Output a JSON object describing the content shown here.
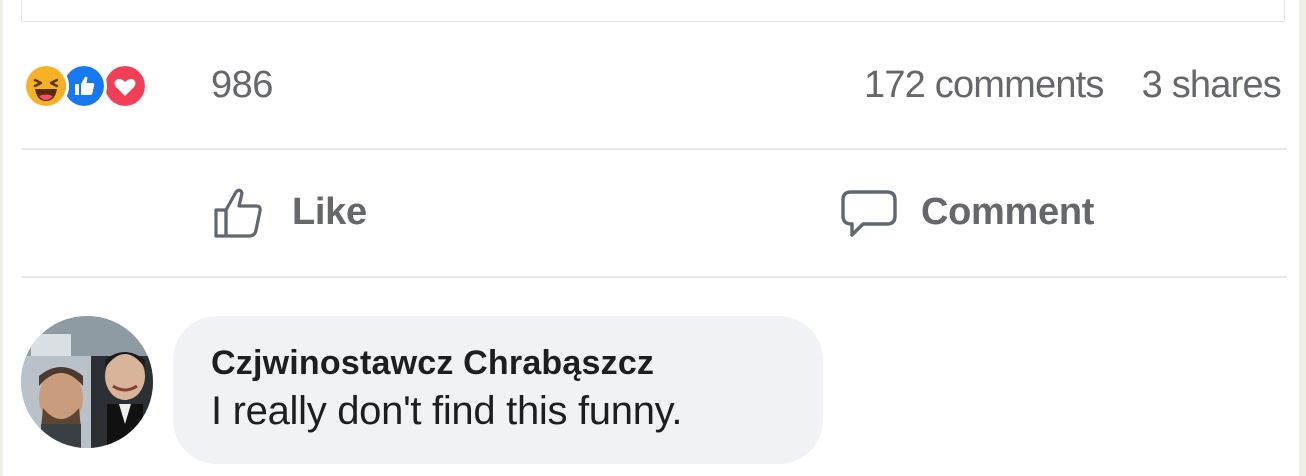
{
  "post": {
    "reactions": {
      "icons": [
        "haha-icon",
        "like-icon",
        "love-icon"
      ],
      "count": "986"
    },
    "comments_count": "172 comments",
    "shares_count": "3 shares"
  },
  "actions": {
    "like_label": "Like",
    "comment_label": "Comment"
  },
  "comment": {
    "author": "Czjwinostawcz Chrabąszcz",
    "text": "I really don't find this funny."
  },
  "colors": {
    "haha": "#f7b125",
    "like": "#1877f2",
    "love": "#f33e58",
    "muted_text": "#65676b",
    "bubble_bg": "#f0f2f5"
  }
}
